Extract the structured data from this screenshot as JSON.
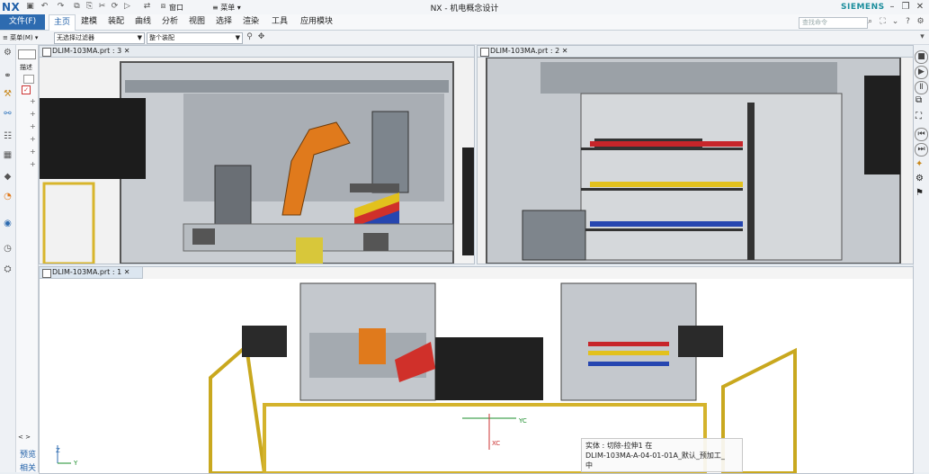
{
  "app": {
    "logo": "NX",
    "title": "NX - 机电概念设计",
    "brand": "SIEMENS"
  },
  "ribbon": {
    "file_label": "文件(F)",
    "tabs": [
      "主页",
      "建模",
      "装配",
      "曲线",
      "分析",
      "视图",
      "选择",
      "渲染",
      "工具",
      "应用模块"
    ],
    "active_tab": "主页",
    "search_placeholder": "查找命令"
  },
  "toolbar": {
    "menu_label": "≡ 菜单(M) ▾",
    "filter_value": "无选择过滤器",
    "scope_value": "整个装配"
  },
  "quick_access": {
    "window_label": "窗口",
    "menu_label": "≡ 菜单 ▾"
  },
  "navigator": {
    "label_top": "描述",
    "bottom_labels": [
      "预览",
      "相关"
    ],
    "scroll_label": "< >"
  },
  "viewports": {
    "top_left_tab": "DLIM-103MA.prt : 3",
    "top_right_tab": "DLIM-103MA.prt : 2",
    "bottom_tab": "DLIM-103MA.prt : 1"
  },
  "tooltip": {
    "line1": "实体 : 切除-拉伸1 在",
    "line2": "DLIM-103MA-A-04-01-01A_默认_预加工_",
    "line3": "中"
  },
  "axis_labels": {
    "xc": "XC",
    "yc": "YC",
    "z": "Z",
    "y": "Y"
  },
  "colors": {
    "accent": "#2d6bb0",
    "brand": "#1a8d9c",
    "robot": "#e07a1c",
    "fence": "#e3c534"
  }
}
